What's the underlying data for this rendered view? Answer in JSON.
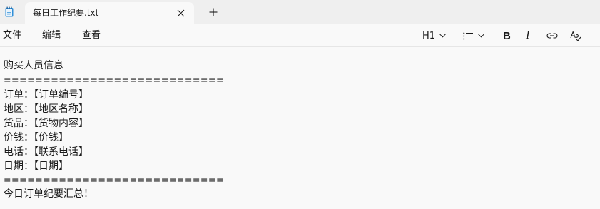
{
  "tab": {
    "title": "每日工作纪要.txt",
    "close_icon": "close-icon",
    "new_tab_icon": "plus-icon"
  },
  "menu": {
    "file": "文件",
    "edit": "编辑",
    "view": "查看"
  },
  "toolbar": {
    "heading_label": "H1",
    "heading_icon": "chevron-down-icon",
    "list_icon": "bulleted-list-icon",
    "bold_label": "B",
    "italic_label": "I",
    "link_icon": "link-icon",
    "spellcheck_icon": "spellcheck-icon"
  },
  "editor": {
    "lines": [
      "购买人员信息",
      "============================",
      "订单：【订单编号】",
      "地区：【地区名称】",
      "货品：【货物内容】",
      "价钱：【价钱】",
      "电话：【联系电话】",
      "日期：【日期】",
      "",
      "============================",
      "今日订单纪要汇总！"
    ]
  }
}
